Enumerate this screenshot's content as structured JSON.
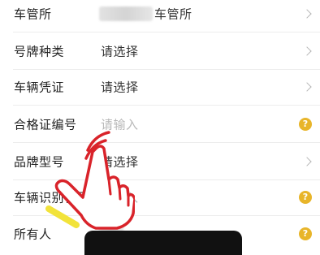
{
  "form": {
    "rows": [
      {
        "label": "车管所",
        "value": "车管所",
        "value_style": "filled",
        "redacted": true,
        "trailing": "chevron-right-icon"
      },
      {
        "label": "号牌种类",
        "value": "请选择",
        "value_style": "filled",
        "trailing": "chevron-right-icon"
      },
      {
        "label": "车辆凭证",
        "value": "请选择",
        "value_style": "filled",
        "trailing": "chevron-right-icon"
      },
      {
        "label": "合格证编号",
        "value": "请输入",
        "value_style": "placeholder",
        "trailing": "help-icon"
      },
      {
        "label": "品牌型号",
        "value": "请选择",
        "value_style": "filled",
        "trailing": "chevron-right-icon"
      },
      {
        "label": "车辆识别代号",
        "value": "请输入",
        "value_style": "placeholder",
        "trailing": "help-icon"
      },
      {
        "label": "所有人",
        "value": "",
        "value_style": "filled",
        "redacted": true,
        "trailing": "help-icon"
      }
    ],
    "help_symbol": "?"
  },
  "colors": {
    "help_icon": "#e8b52a",
    "placeholder_text": "#b8b8b8",
    "hand_outline": "#d9232a",
    "hand_underline": "#f2e33a",
    "bottom_bar": "#111111"
  },
  "overlay": {
    "icon": "tap-hand-icon"
  }
}
